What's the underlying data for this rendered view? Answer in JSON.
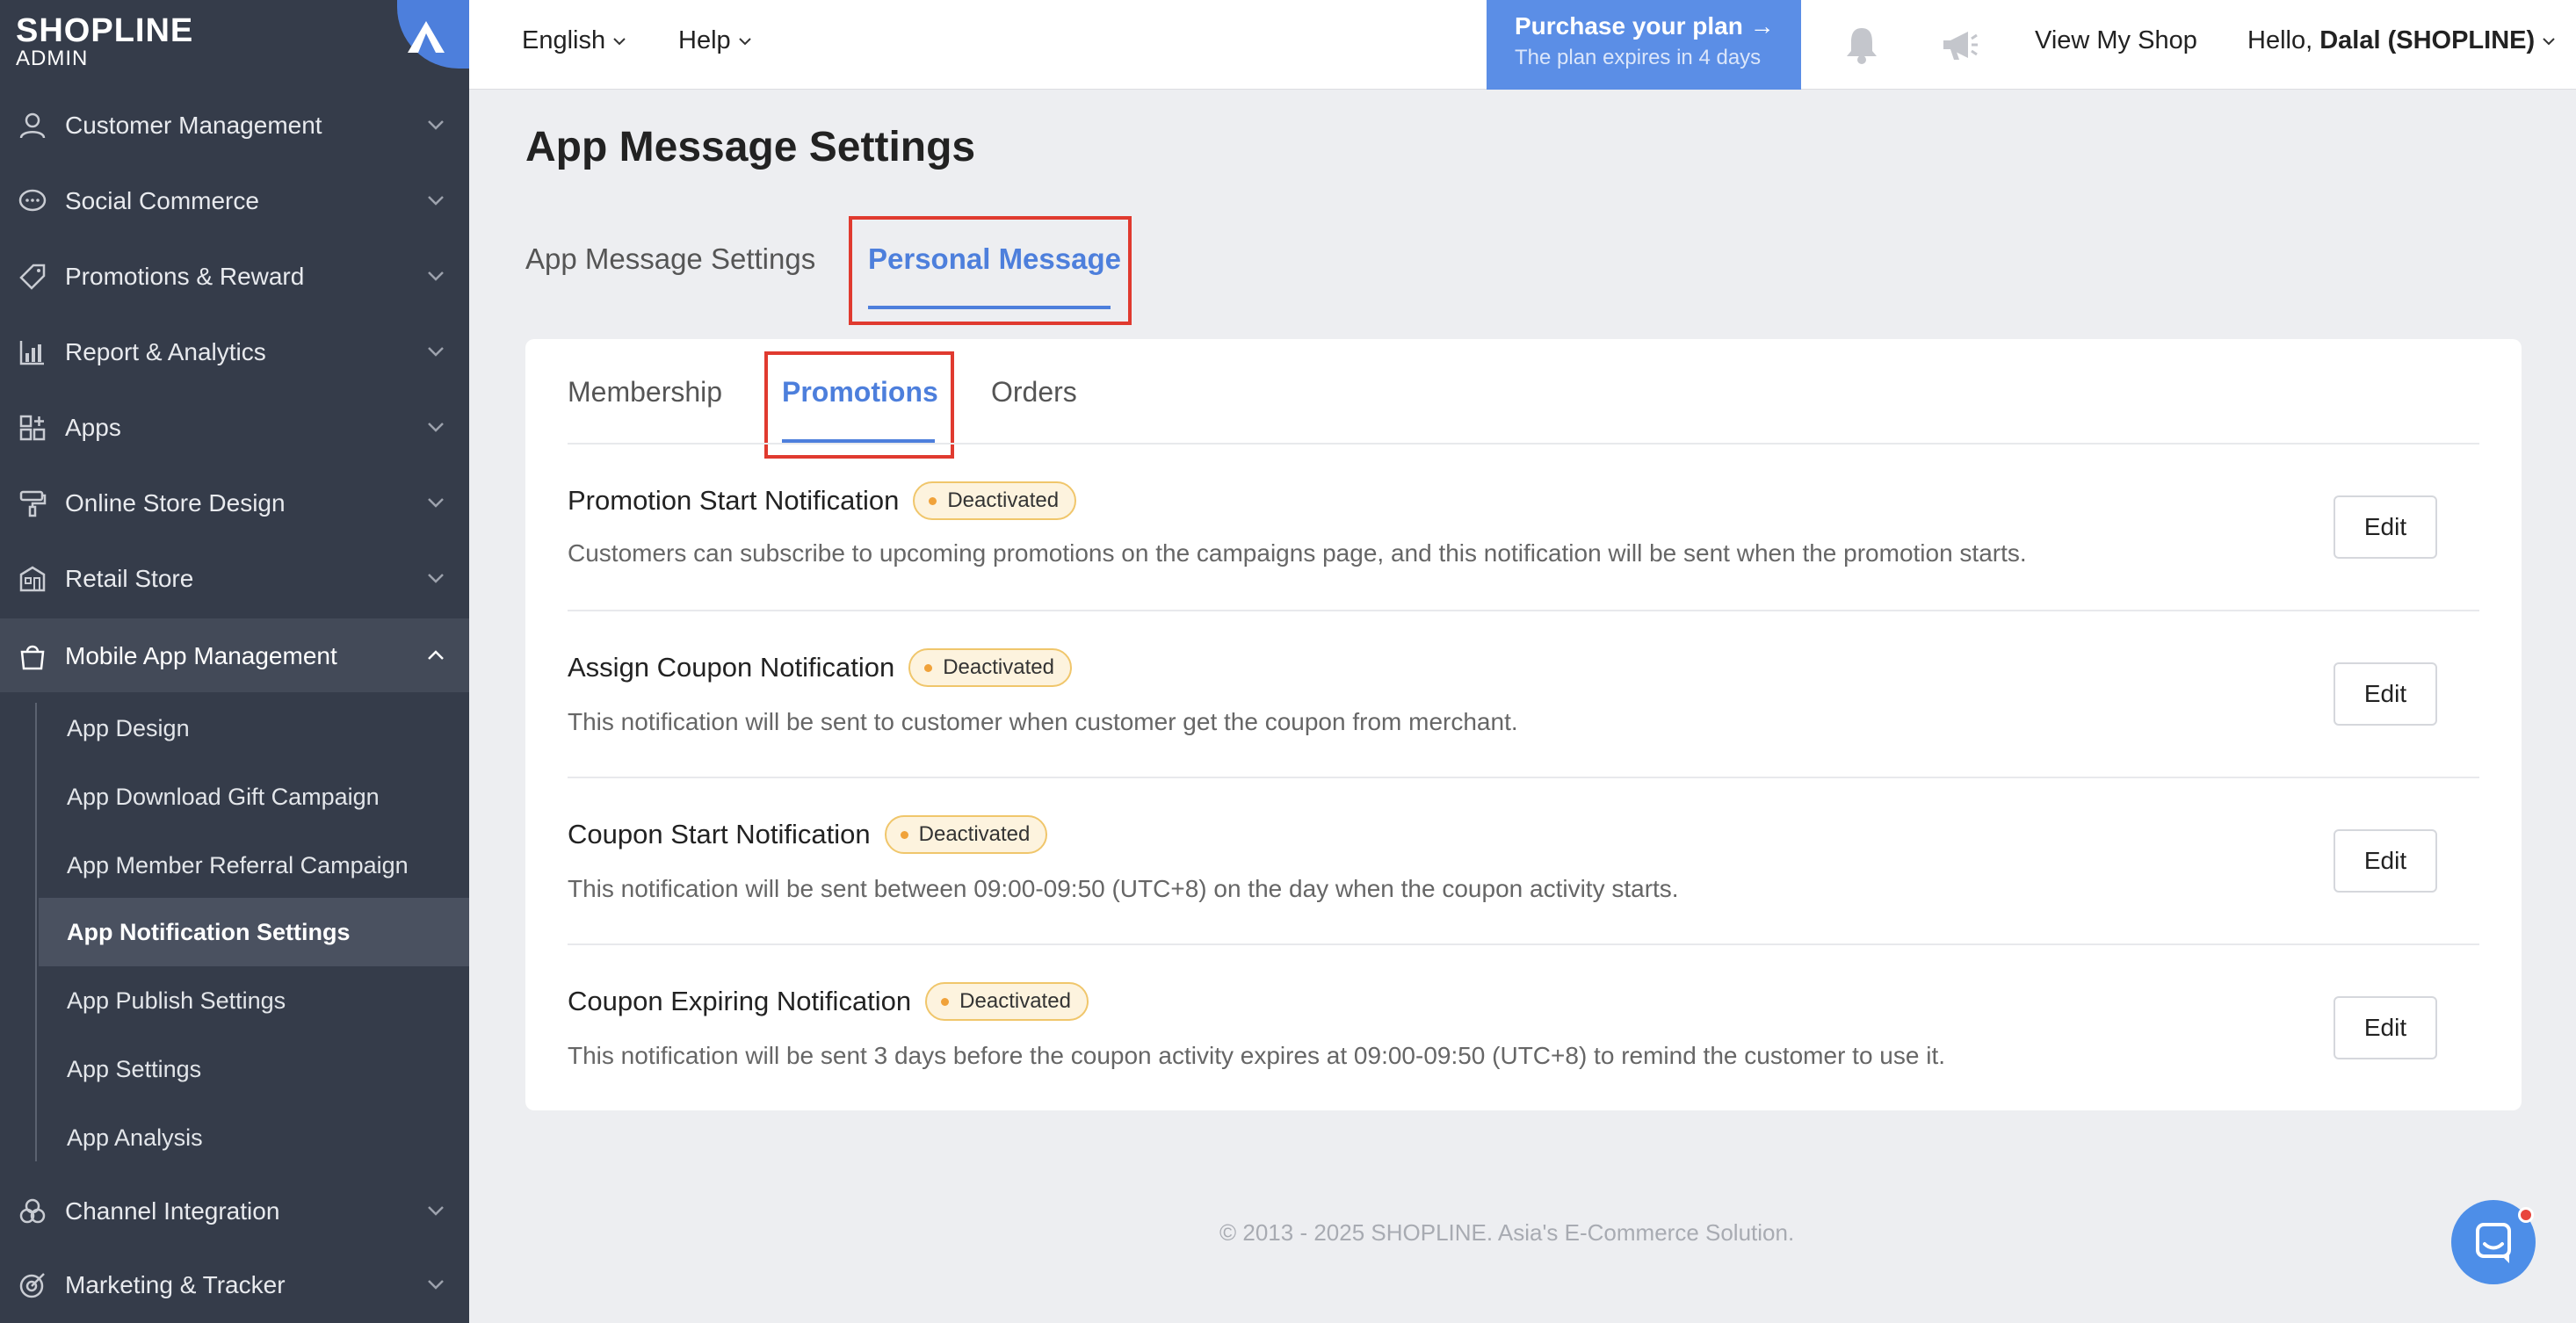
{
  "sidebar": {
    "logo_brand": "SHOPLINE",
    "logo_sub": "ADMIN",
    "items": [
      {
        "label": "Customer Management",
        "icon": "user-icon"
      },
      {
        "label": "Social Commerce",
        "icon": "chat-bubble-icon"
      },
      {
        "label": "Promotions & Reward",
        "icon": "tag-icon"
      },
      {
        "label": "Report & Analytics",
        "icon": "chart-icon"
      },
      {
        "label": "Apps",
        "icon": "apps-grid-icon"
      },
      {
        "label": "Online Store Design",
        "icon": "paint-roller-icon"
      },
      {
        "label": "Retail Store",
        "icon": "store-icon"
      },
      {
        "label": "Mobile App Management",
        "icon": "shopping-bag-icon"
      },
      {
        "label": "Channel Integration",
        "icon": "channels-icon"
      },
      {
        "label": "Marketing & Tracker",
        "icon": "target-icon"
      }
    ],
    "sub_items": [
      {
        "label": "App Design"
      },
      {
        "label": "App Download Gift Campaign"
      },
      {
        "label": "App Member Referral Campaign"
      },
      {
        "label": "App Notification Settings"
      },
      {
        "label": "App Publish Settings"
      },
      {
        "label": "App Settings"
      },
      {
        "label": "App Analysis"
      }
    ]
  },
  "topbar": {
    "language": "English",
    "help": "Help",
    "purchase_title": "Purchase your plan →",
    "purchase_sub": "The plan expires in 4 days",
    "view_shop": "View My Shop",
    "greeting": "Hello,",
    "user_name": "Dalal (SHOPLINE)"
  },
  "page": {
    "title": "App Message Settings",
    "tabs": [
      {
        "label": "App Message Settings"
      },
      {
        "label": "Personal Message"
      }
    ],
    "subtabs": [
      {
        "label": "Membership"
      },
      {
        "label": "Promotions"
      },
      {
        "label": "Orders"
      }
    ],
    "notifications": [
      {
        "title": "Promotion Start Notification",
        "status": "Deactivated",
        "description": "Customers can subscribe to upcoming promotions on the campaigns page, and this notification will be sent when the promotion starts.",
        "action": "Edit"
      },
      {
        "title": "Assign Coupon Notification",
        "status": "Deactivated",
        "description": "This notification will be sent to customer when customer get the coupon from merchant.",
        "action": "Edit"
      },
      {
        "title": "Coupon Start Notification",
        "status": "Deactivated",
        "description": "This notification will be sent between 09:00-09:50 (UTC+8) on the day when the coupon activity starts.",
        "action": "Edit"
      },
      {
        "title": "Coupon Expiring Notification",
        "status": "Deactivated",
        "description": "This notification will be sent 3 days before the coupon activity expires at 09:00-09:50 (UTC+8) to remind the customer to use it.",
        "action": "Edit"
      }
    ],
    "footer": "© 2013 - 2025  SHOPLINE. Asia's E-Commerce Solution."
  },
  "colors": {
    "sidebar_bg": "#353c4a",
    "accent": "#4d7fdc",
    "highlight": "#e03a2f",
    "badge_bg": "#fdf3de"
  }
}
